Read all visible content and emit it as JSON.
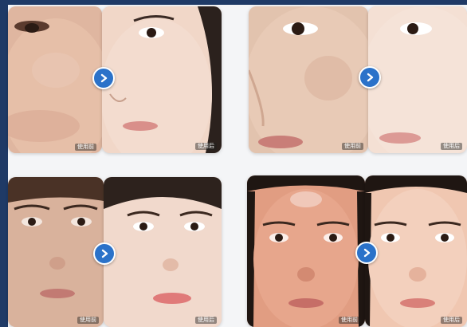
{
  "colors": {
    "background_frame": "#1f3a66",
    "card_background": "#f4f5f7",
    "arrow_blue": "#2b72c9"
  },
  "comparisons": [
    {
      "before_label": "使用前",
      "after_label": "使用后"
    },
    {
      "before_label": "使用前",
      "after_label": "使用后"
    },
    {
      "before_label": "使用前",
      "after_label": "使用后"
    },
    {
      "before_label": "使用前",
      "after_label": "使用后"
    }
  ],
  "icons": {
    "arrow": "chevron-right-circle-icon"
  }
}
